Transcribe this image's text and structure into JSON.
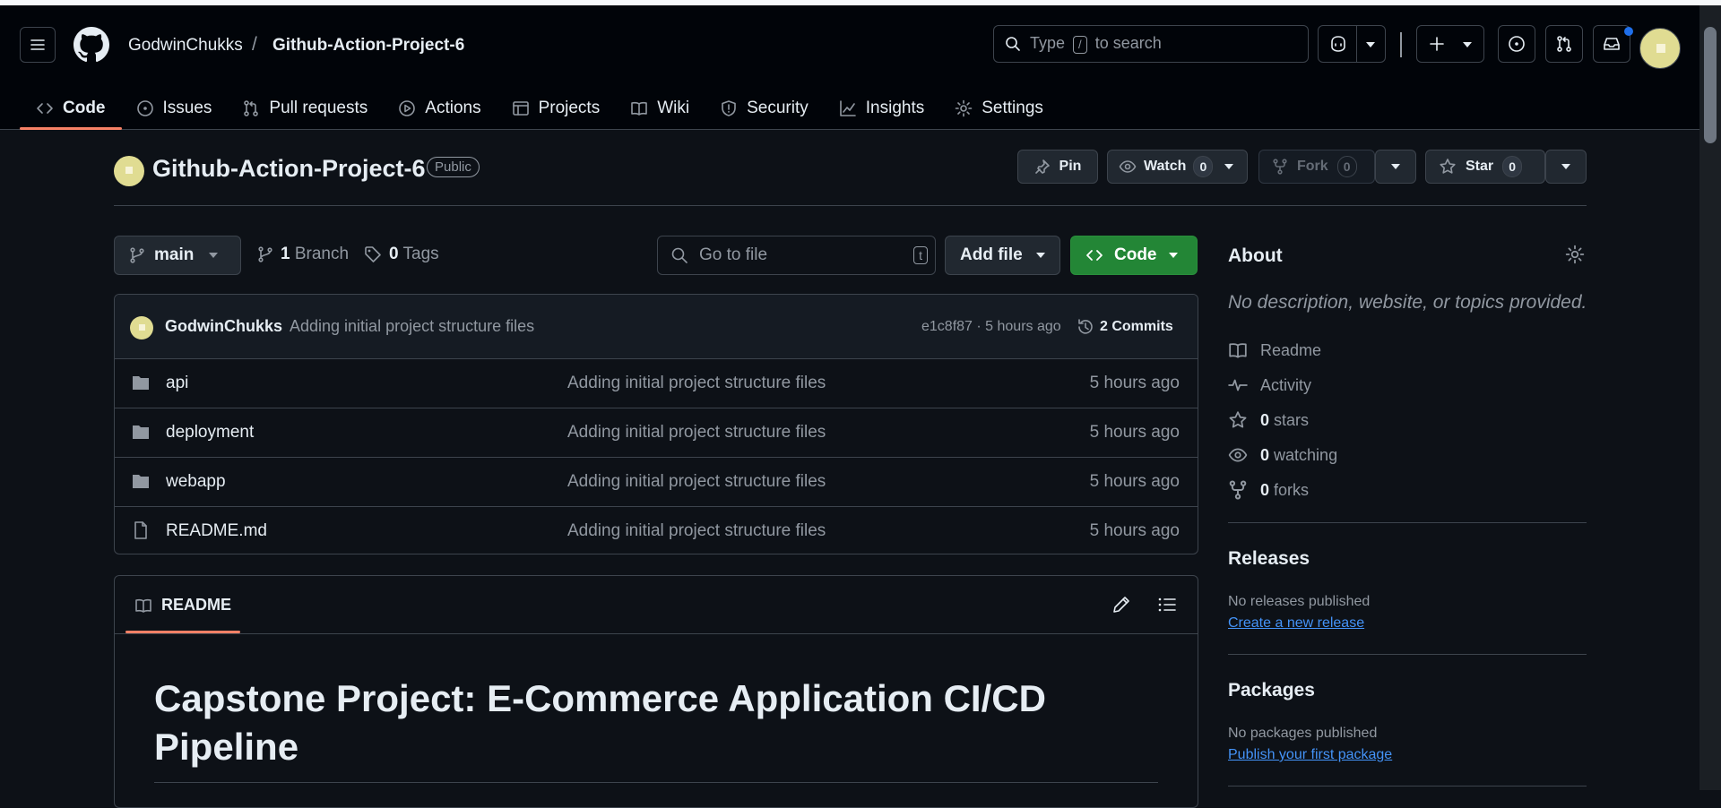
{
  "header": {
    "owner": "GodwinChukks",
    "separator": "/",
    "repo": "Github-Action-Project-6",
    "search_prefix": "Type",
    "search_key": "/",
    "search_suffix": "to search"
  },
  "tabs": [
    {
      "label": "Code",
      "icon": "code-icon",
      "active": true
    },
    {
      "label": "Issues",
      "icon": "issue-opened-icon"
    },
    {
      "label": "Pull requests",
      "icon": "git-pull-request-icon"
    },
    {
      "label": "Actions",
      "icon": "play-icon"
    },
    {
      "label": "Projects",
      "icon": "table-icon"
    },
    {
      "label": "Wiki",
      "icon": "book-icon"
    },
    {
      "label": "Security",
      "icon": "shield-icon"
    },
    {
      "label": "Insights",
      "icon": "graph-icon"
    },
    {
      "label": "Settings",
      "icon": "gear-icon"
    }
  ],
  "repo_header": {
    "title": "Github-Action-Project-6",
    "visibility": "Public",
    "pin": "Pin",
    "watch": "Watch",
    "watch_count": "0",
    "fork": "Fork",
    "fork_count": "0",
    "star": "Star",
    "star_count": "0"
  },
  "branch_bar": {
    "branch": "main",
    "branch_count": "1",
    "branch_label": "Branch",
    "tag_count": "0",
    "tag_label": "Tags",
    "goto_placeholder": "Go to file",
    "goto_key": "t",
    "add_file": "Add file",
    "code": "Code"
  },
  "latest_commit": {
    "author": "GodwinChukks",
    "message": "Adding initial project structure files",
    "meta": "e1c8f87 · 5 hours ago",
    "commits": "2 Commits"
  },
  "files": [
    {
      "name": "api",
      "type": "folder",
      "message": "Adding initial project structure files",
      "time": "5 hours ago"
    },
    {
      "name": "deployment",
      "type": "folder",
      "message": "Adding initial project structure files",
      "time": "5 hours ago"
    },
    {
      "name": "webapp",
      "type": "folder",
      "message": "Adding initial project structure files",
      "time": "5 hours ago"
    },
    {
      "name": "README.md",
      "type": "file",
      "message": "Adding initial project structure files",
      "time": "5 hours ago"
    }
  ],
  "readme": {
    "tab": "README",
    "heading": "Capstone Project: E-Commerce Application CI/CD Pipeline"
  },
  "sidebar": {
    "about_title": "About",
    "description": "No description, website, or topics provided.",
    "readme": "Readme",
    "activity": "Activity",
    "stars_count": "0",
    "stars_label": "stars",
    "watching_count": "0",
    "watching_label": "watching",
    "forks_count": "0",
    "forks_label": "forks",
    "releases_title": "Releases",
    "releases_text": "No releases published",
    "releases_link": "Create a new release",
    "packages_title": "Packages",
    "packages_text": "No packages published",
    "packages_link": "Publish your first package"
  },
  "colors": {
    "background": "#0d1117",
    "header": "#010409",
    "accent": "#f78166",
    "green": "#238636",
    "link": "#4493f8"
  }
}
